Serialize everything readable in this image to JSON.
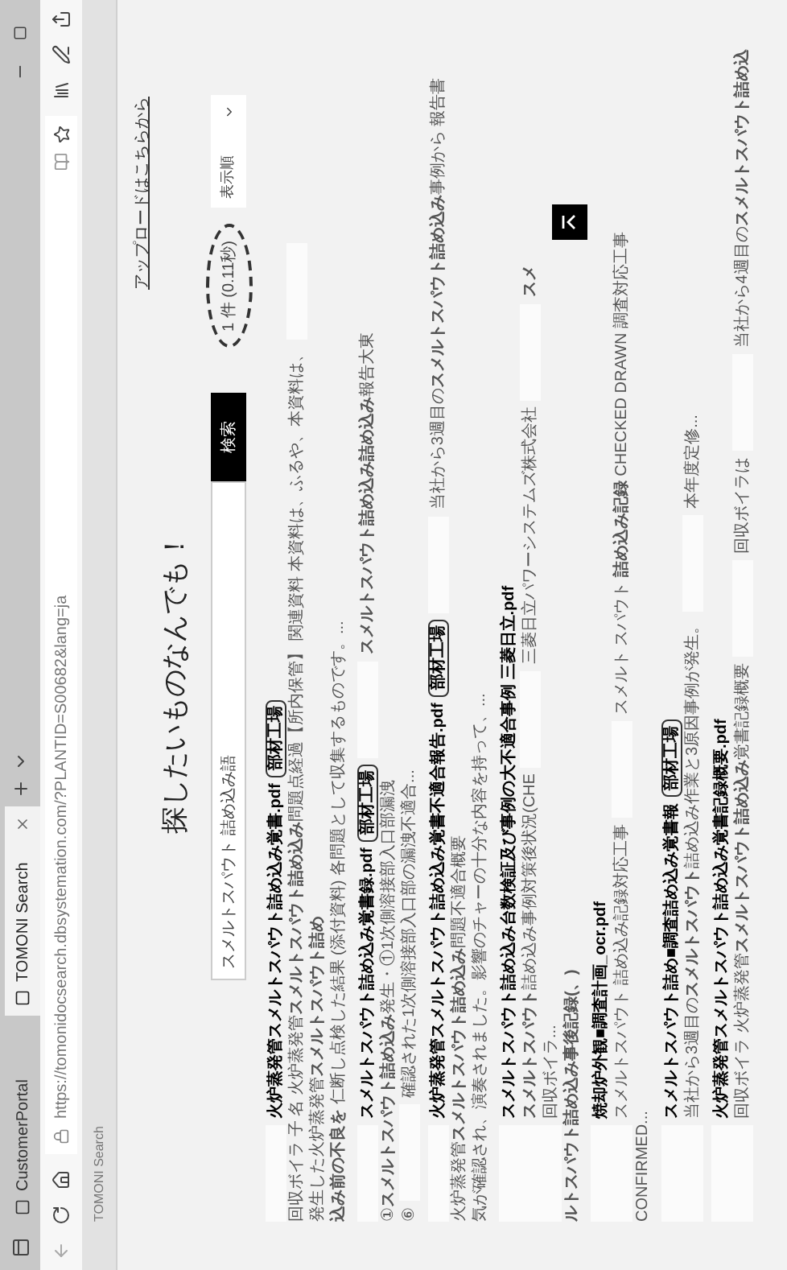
{
  "browser": {
    "tabs": [
      {
        "label": "CustomerPortal",
        "selected": false
      },
      {
        "label": "TOMONI Search",
        "selected": true
      }
    ],
    "url": "https://tomonidocsearch.dbsystemation.com/?PLANTID=S00682&lang=ja",
    "favorites_bar": [
      "TOMONI Search"
    ]
  },
  "page": {
    "upload_link": "アップロードはこちらから",
    "heading": "探したいものなんでも！",
    "search": {
      "value": "スメルトスパウト 詰め込み語"
    },
    "search_button": "検索",
    "result_count": {
      "text": "1 件 (0.11秒)",
      "highlighted": true
    },
    "sort": {
      "value": "表示順"
    },
    "results": [
      {
        "lines": [
          [
            {
              "kind": "redaction"
            },
            {
              "kind": "link",
              "text": "火炉蒸発管スメルトスパウト詰め込み覚書.pdf"
            },
            {
              "kind": "tag",
              "text": "部材工場"
            }
          ],
          [
            {
              "kind": "text",
              "text": "回収ボイラ 子 名 火炉蒸発管**スメルトスパウト詰め込み**問題点経過【所内保管】 関連資料 本資料は、ふるや、本資料は、"
            },
            {
              "kind": "redaction"
            },
            {
              "kind": "text",
              "text": "発生した火炉蒸発管**スメルトスパウト詰め**"
            }
          ],
          [
            {
              "kind": "text",
              "text": "**込み前の不良を** 仁断し点検した結果 (添付資料) 各問題として収集するものです。..."
            }
          ]
        ]
      },
      {
        "lines": [
          [
            {
              "kind": "redaction"
            },
            {
              "kind": "link",
              "text": "スメルトスパウト詰め込み覚書録.pdf"
            },
            {
              "kind": "tag",
              "text": "部材工場"
            },
            {
              "kind": "redaction"
            },
            {
              "kind": "text",
              "text": "**スメルトスパウト詰め込み詰め込み**報告大東"
            }
          ],
          [
            {
              "kind": "text",
              "text": "①**スメルトスパウト詰め込み**発生・①1次側溶接部入口部漏洩"
            }
          ],
          [
            {
              "kind": "text",
              "text": "⑥"
            },
            {
              "kind": "redaction"
            },
            {
              "kind": "text",
              "text": "確認された1次側溶接部入口部の漏洩不適合..."
            }
          ]
        ]
      },
      {
        "lines": [
          [
            {
              "kind": "redaction"
            },
            {
              "kind": "link",
              "text": "火炉蒸発管スメルトスパウト詰め込み覚書不適合報告.pdf"
            },
            {
              "kind": "tag",
              "text": "部材工場"
            },
            {
              "kind": "redaction"
            },
            {
              "kind": "text",
              "text": "当社から3週目の**スメルトスパウト詰め込み**事例から 報告書"
            }
          ],
          [
            {
              "kind": "text",
              "text": "火炉蒸発管**スメルトスパウト詰め込み**問題不適合概要"
            }
          ],
          [
            {
              "kind": "text",
              "text": "気が確認され、演奏されました。影響のチャーの十分な内容を持って、..."
            }
          ]
        ]
      },
      {
        "lines": [
          [
            {
              "kind": "redaction"
            },
            {
              "kind": "link",
              "text": "スメルトスパウト詰め込み台数検証及び事例の大不適合事例 三菱日立.pdf"
            }
          ],
          [
            {
              "kind": "redaction"
            },
            {
              "kind": "text",
              "text": "**スメルトスパウト**詰め込み事例対策後状況(CHE"
            },
            {
              "kind": "redaction"
            },
            {
              "kind": "text",
              "text": "三菱日立パワーシステムズ株式会社"
            },
            {
              "kind": "redaction"
            },
            {
              "kind": "text",
              "text": "**スメ**"
            }
          ],
          [
            {
              "kind": "redaction"
            },
            {
              "kind": "text",
              "text": "回収ボイラ..."
            }
          ],
          [
            {
              "kind": "text",
              "text": "**ルトスパウト詰め込み事後記録(、)**"
            }
          ]
        ]
      },
      {
        "lines": [
          [
            {
              "kind": "redaction"
            },
            {
              "kind": "link",
              "text": "焼却炉外観■調査計画_ocr.pdf"
            }
          ],
          [
            {
              "kind": "redaction"
            },
            {
              "kind": "text",
              "text": "スメルトスパウト 詰め込み記録対応工事"
            },
            {
              "kind": "redaction"
            },
            {
              "kind": "text",
              "text": "スメルト スパウト **詰め込み記録** CHECKED DRAWN 調査対応工事"
            }
          ],
          [
            {
              "kind": "text",
              "text": "CONFIRMED..."
            }
          ]
        ]
      },
      {
        "lines": [
          [
            {
              "kind": "redaction"
            },
            {
              "kind": "link",
              "text": "スメルトスパウト詰め■調査詰め込み覚書報"
            },
            {
              "kind": "tag",
              "text": "部材工場"
            }
          ],
          [
            {
              "kind": "redaction"
            },
            {
              "kind": "text",
              "text": "当社から3週目の**スメルトスパウト**詰め込み作業と3原因事例が発生。"
            },
            {
              "kind": "redaction"
            },
            {
              "kind": "text",
              "text": "本年度定修..."
            }
          ]
        ]
      },
      {
        "lines": [
          [
            {
              "kind": "redaction"
            },
            {
              "kind": "link",
              "text": "火炉蒸発管スメルトスパウト詰め込み覚書記録概要.pdf"
            }
          ],
          [
            {
              "kind": "redaction"
            },
            {
              "kind": "text",
              "text": "回収ボイラ 火炉蒸発管**スメルトスパウト詰め込み**覚書記録概要"
            },
            {
              "kind": "redaction"
            },
            {
              "kind": "text",
              "text": "回収ボイラは"
            },
            {
              "kind": "redaction"
            },
            {
              "kind": "text",
              "text": "当社から4週目の**スメルトスパウト詰め込**"
            }
          ]
        ]
      }
    ]
  }
}
